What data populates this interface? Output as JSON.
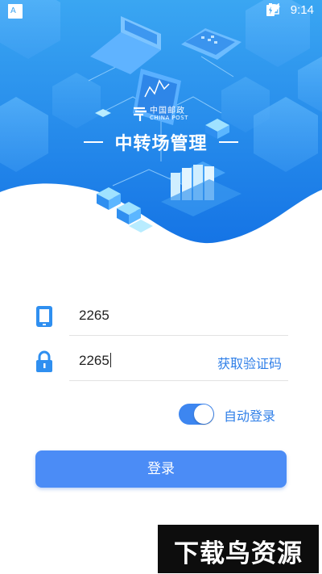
{
  "status_bar": {
    "time": "9:14",
    "icons": [
      "keyboard-icon",
      "image-icon",
      "square-icon",
      "font-icon",
      "wifi-icon",
      "signal-icon",
      "battery-icon"
    ]
  },
  "brand": {
    "name_cn": "中国邮政",
    "name_en": "CHINA POST"
  },
  "app": {
    "title": "中转场管理"
  },
  "form": {
    "account_value": "2265",
    "code_value": "2265",
    "get_code_label": "获取验证码",
    "auto_login_label": "自动登录",
    "auto_login_on": true,
    "login_label": "登录"
  },
  "watermark": {
    "text": "下载鸟资源"
  },
  "colors": {
    "primary": "#2f7fe8",
    "button": "#4b8cf6",
    "hero_top": "#3aa2f0",
    "hero_bottom": "#1677e6"
  }
}
